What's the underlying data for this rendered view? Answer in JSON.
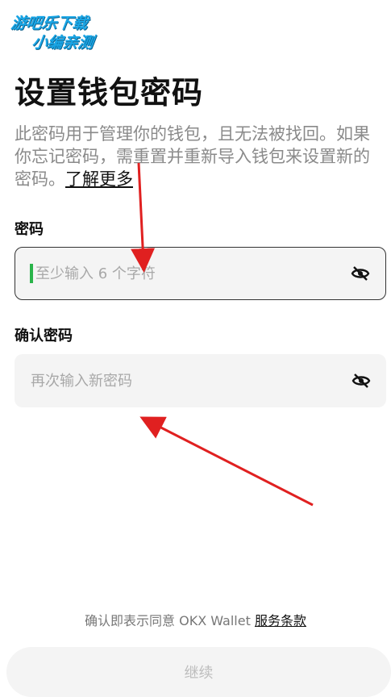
{
  "watermark": {
    "line1": "游吧乐下载",
    "line2": "小编亲测"
  },
  "page": {
    "title": "设置钱包密码",
    "description": "此密码用于管理你的钱包，且无法被找回。如果你忘记密码，需重置并重新导入钱包来设置新的密码。",
    "learn_more": "了解更多"
  },
  "password": {
    "label": "密码",
    "placeholder": "至少输入 6 个字符",
    "value": "",
    "visibility_icon": "eye-off-icon"
  },
  "confirm_password": {
    "label": "确认密码",
    "placeholder": "再次输入新密码",
    "value": "",
    "visibility_icon": "eye-off-icon"
  },
  "footer": {
    "terms_prefix": "确认即表示同意 OKX Wallet ",
    "terms_link": "服务条款",
    "continue_label": "继续"
  },
  "colors": {
    "annotation_arrow": "#e02020",
    "cursor": "#2ab44a",
    "field_bg": "#f4f4f4",
    "watermark": "#1aa6e6"
  }
}
